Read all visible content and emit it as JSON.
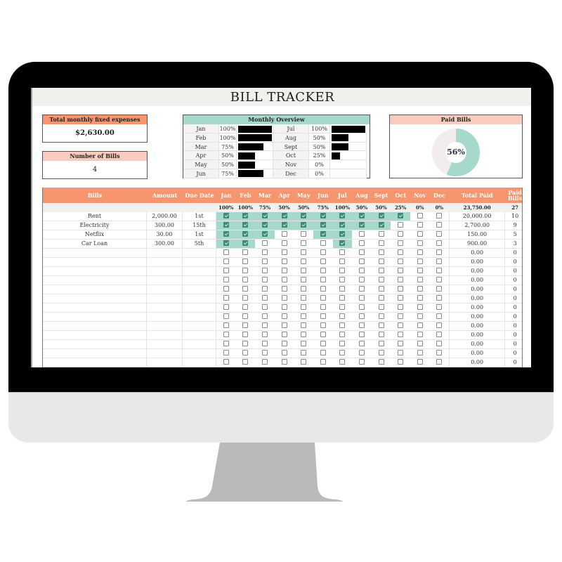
{
  "app": {
    "title": "BILL TRACKER"
  },
  "summary": {
    "total_label": "Total monthly fixed expenses",
    "total_value": "$2,630.00",
    "count_label": "Number of Bills",
    "count_value": "4"
  },
  "overview": {
    "title": "Monthly Overview",
    "left": [
      {
        "month": "Jan",
        "pct": "100%",
        "fraction": 1.0
      },
      {
        "month": "Feb",
        "pct": "100%",
        "fraction": 1.0
      },
      {
        "month": "Mar",
        "pct": "75%",
        "fraction": 0.75
      },
      {
        "month": "Apr",
        "pct": "50%",
        "fraction": 0.5
      },
      {
        "month": "May",
        "pct": "50%",
        "fraction": 0.5
      },
      {
        "month": "Jun",
        "pct": "75%",
        "fraction": 0.75
      }
    ],
    "right": [
      {
        "month": "Jul",
        "pct": "100%",
        "fraction": 1.0
      },
      {
        "month": "Aug",
        "pct": "50%",
        "fraction": 0.5
      },
      {
        "month": "Sept",
        "pct": "50%",
        "fraction": 0.5
      },
      {
        "month": "Oct",
        "pct": "25%",
        "fraction": 0.25
      },
      {
        "month": "Nov",
        "pct": "0%",
        "fraction": 0
      },
      {
        "month": "Dec",
        "pct": "0%",
        "fraction": 0
      }
    ]
  },
  "paid_bills": {
    "title": "Paid Bills",
    "label": "56%",
    "fraction": 0.5625,
    "colors": {
      "paid": "#a6d9cb",
      "unpaid": "#f3ecec"
    }
  },
  "table": {
    "headers": {
      "bills": "Bills",
      "amount": "Amount",
      "due_date": "Due Date",
      "months": [
        "Jan",
        "Feb",
        "Mar",
        "Apr",
        "May",
        "Jun",
        "Jul",
        "Aug",
        "Sept",
        "Oct",
        "Nov",
        "Dec"
      ],
      "total_paid": "Total Paid",
      "paid_bills": "Paid Bills"
    },
    "month_pcts": [
      "100%",
      "100%",
      "75%",
      "50%",
      "50%",
      "75%",
      "100%",
      "50%",
      "50%",
      "25%",
      "0%",
      "0%"
    ],
    "total_paid_sum": "23,750.00",
    "paid_bills_sum": "27",
    "rows": [
      {
        "bill": "Rent",
        "amount": "2,000.00",
        "due": "1st",
        "paid": [
          1,
          1,
          1,
          1,
          1,
          1,
          1,
          1,
          1,
          1,
          0,
          0
        ],
        "total": "20,000.00",
        "count": "10"
      },
      {
        "bill": "Electricity",
        "amount": "300.00",
        "due": "15th",
        "paid": [
          1,
          1,
          1,
          1,
          1,
          1,
          1,
          1,
          1,
          0,
          0,
          0
        ],
        "total": "2,700.00",
        "count": "9"
      },
      {
        "bill": "Netflix",
        "amount": "30.00",
        "due": "1st",
        "paid": [
          1,
          1,
          1,
          0,
          0,
          1,
          1,
          0,
          0,
          0,
          0,
          0
        ],
        "total": "150.00",
        "count": "5"
      },
      {
        "bill": "Car Loan",
        "amount": "300.00",
        "due": "5th",
        "paid": [
          1,
          1,
          0,
          0,
          0,
          0,
          1,
          0,
          0,
          0,
          0,
          0
        ],
        "total": "900.00",
        "count": "3"
      },
      {
        "bill": "",
        "amount": "",
        "due": "",
        "paid": [
          0,
          0,
          0,
          0,
          0,
          0,
          0,
          0,
          0,
          0,
          0,
          0
        ],
        "total": "0.00",
        "count": "0"
      },
      {
        "bill": "",
        "amount": "",
        "due": "",
        "paid": [
          0,
          0,
          0,
          0,
          0,
          0,
          0,
          0,
          0,
          0,
          0,
          0
        ],
        "total": "0.00",
        "count": "0"
      },
      {
        "bill": "",
        "amount": "",
        "due": "",
        "paid": [
          0,
          0,
          0,
          0,
          0,
          0,
          0,
          0,
          0,
          0,
          0,
          0
        ],
        "total": "0.00",
        "count": "0"
      },
      {
        "bill": "",
        "amount": "",
        "due": "",
        "paid": [
          0,
          0,
          0,
          0,
          0,
          0,
          0,
          0,
          0,
          0,
          0,
          0
        ],
        "total": "0.00",
        "count": "0"
      },
      {
        "bill": "",
        "amount": "",
        "due": "",
        "paid": [
          0,
          0,
          0,
          0,
          0,
          0,
          0,
          0,
          0,
          0,
          0,
          0
        ],
        "total": "0.00",
        "count": "0"
      },
      {
        "bill": "",
        "amount": "",
        "due": "",
        "paid": [
          0,
          0,
          0,
          0,
          0,
          0,
          0,
          0,
          0,
          0,
          0,
          0
        ],
        "total": "0.00",
        "count": "0"
      },
      {
        "bill": "",
        "amount": "",
        "due": "",
        "paid": [
          0,
          0,
          0,
          0,
          0,
          0,
          0,
          0,
          0,
          0,
          0,
          0
        ],
        "total": "0.00",
        "count": "0"
      },
      {
        "bill": "",
        "amount": "",
        "due": "",
        "paid": [
          0,
          0,
          0,
          0,
          0,
          0,
          0,
          0,
          0,
          0,
          0,
          0
        ],
        "total": "0.00",
        "count": "0"
      },
      {
        "bill": "",
        "amount": "",
        "due": "",
        "paid": [
          0,
          0,
          0,
          0,
          0,
          0,
          0,
          0,
          0,
          0,
          0,
          0
        ],
        "total": "0.00",
        "count": "0"
      },
      {
        "bill": "",
        "amount": "",
        "due": "",
        "paid": [
          0,
          0,
          0,
          0,
          0,
          0,
          0,
          0,
          0,
          0,
          0,
          0
        ],
        "total": "0.00",
        "count": "0"
      },
      {
        "bill": "",
        "amount": "",
        "due": "",
        "paid": [
          0,
          0,
          0,
          0,
          0,
          0,
          0,
          0,
          0,
          0,
          0,
          0
        ],
        "total": "0.00",
        "count": "0"
      },
      {
        "bill": "",
        "amount": "",
        "due": "",
        "paid": [
          0,
          0,
          0,
          0,
          0,
          0,
          0,
          0,
          0,
          0,
          0,
          0
        ],
        "total": "0.00",
        "count": "0"
      },
      {
        "bill": "",
        "amount": "",
        "due": "",
        "paid": [
          0,
          0,
          0,
          0,
          0,
          0,
          0,
          0,
          0,
          0,
          0,
          0
        ],
        "total": "0.00",
        "count": "0"
      }
    ]
  },
  "colors": {
    "header_orange": "#f7956f",
    "pink": "#f8cbbf",
    "teal": "#a6d9cb",
    "check_green": "#3f8a72"
  }
}
